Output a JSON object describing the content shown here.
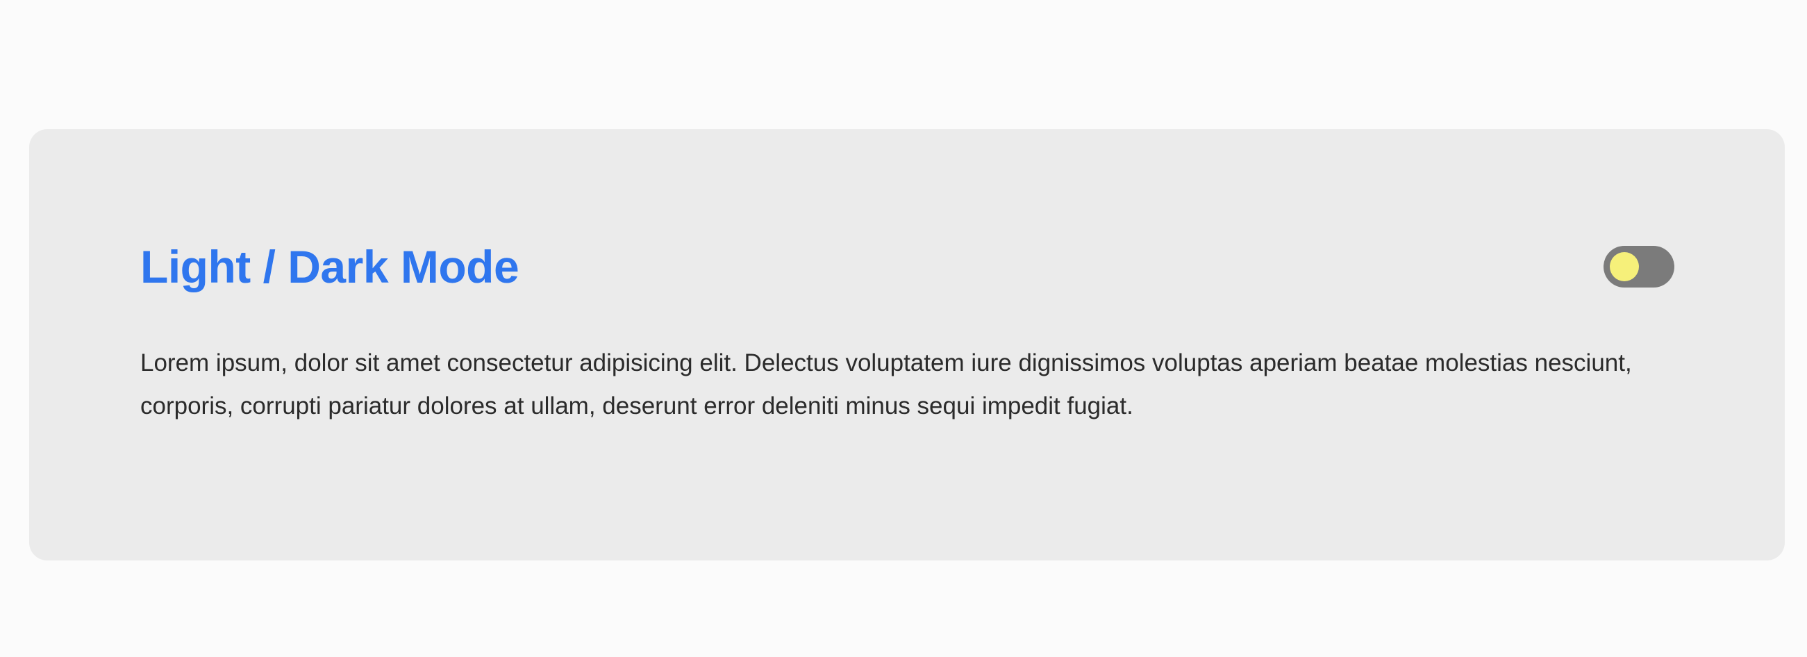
{
  "card": {
    "title": "Light / Dark Mode",
    "body": "Lorem ipsum, dolor sit amet consectetur adipisicing elit. Delectus voluptatem iure dignissimos voluptas aperiam beatae molestias nesciunt, corporis, corrupti pariatur dolores at ullam, deserunt error deleniti minus sequi impedit fugiat."
  },
  "theme_toggle": {
    "icon": "sun-icon",
    "state": "light"
  },
  "colors": {
    "accent": "#2f76ee",
    "card_background": "#ebebeb",
    "page_background": "#fbfbfb",
    "toggle_track": "#7b7b7b",
    "toggle_knob": "#f6f07a",
    "body_text": "#2b2b2b"
  }
}
